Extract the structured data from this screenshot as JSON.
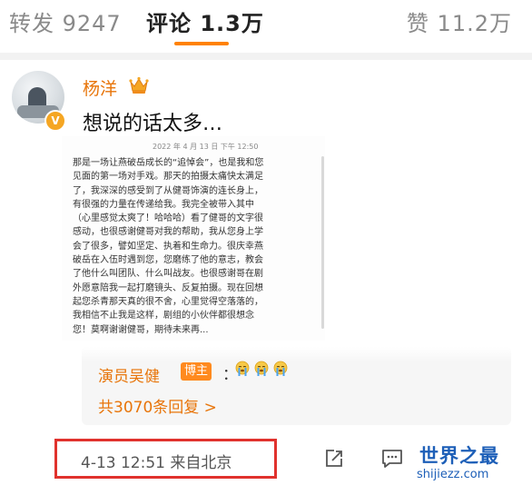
{
  "tabs": {
    "repost": "转发 9247",
    "comment": "评论 1.3万",
    "like": "赞 11.2万"
  },
  "comment": {
    "username": "杨洋",
    "verified_badge": "V",
    "text": "想说的话太多…"
  },
  "letter": {
    "timestamp": "2022 年 4 月 13 日 下午 12:50",
    "lines": [
      "那是一场让燕破岳成长的“追悼会”，也是我和您",
      "见面的第一场对手戏。那天的拍摄太痛快太满足",
      "了，我深深的感受到了从健哥饰演的连长身上，",
      "有很强的力量在传递给我。我完全被带入其中",
      "（心里感觉太爽了！哈哈哈）看了健哥的文字很",
      "感动，也很感谢健哥对我的帮助，我从您身上学",
      "会了很多，譬如坚定、执着和生命力。很庆幸燕",
      "破岳在入伍时遇到您，您磨练了他的意志，教会",
      "了他什么叫团队、什么叫战友。也很感谢哥在剧",
      "外愿意陪我一起打磨镜头、反复拍摄。现在回想",
      "起您杀青那天真的很不舍，心里觉得空落落的，",
      "我相信不止我是这样，剧组的小伙伴都很想念",
      "您！莫啊谢谢健哥，期待未来再..."
    ]
  },
  "reply": {
    "author": "演员吴健",
    "badge": "博主",
    "colon": "：",
    "emoji_icon": "cry-face-emoji",
    "count_label": "共3070条回复 >"
  },
  "footer": {
    "timestamp": "4-13 12:51  来自北京",
    "share_icon": "share-edit-icon",
    "comment_icon": "comment-bubble-icon"
  },
  "watermark": {
    "title": "世界之最",
    "url": "shijiezz.com"
  },
  "colors": {
    "accent": "#ff8200",
    "username": "#e8750a",
    "highlight": "#e0322d",
    "watermark": "#1d5fb8"
  }
}
